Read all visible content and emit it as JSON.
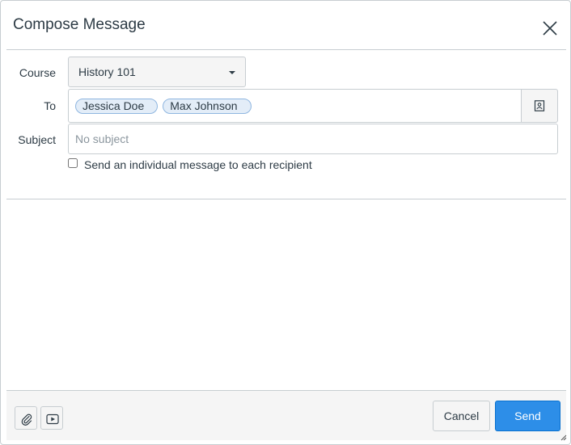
{
  "dialog": {
    "title": "Compose Message"
  },
  "form": {
    "course_label": "Course",
    "course_value": "History 101",
    "to_label": "To",
    "recipients": [
      "Jessica Doe",
      "Max Johnson"
    ],
    "subject_label": "Subject",
    "subject_placeholder": "No subject",
    "subject_value": "",
    "individual_message_label": "Send an individual message to each recipient",
    "individual_message_checked": false
  },
  "footer": {
    "cancel_label": "Cancel",
    "send_label": "Send"
  },
  "icons": {
    "close": "close-icon",
    "address_book": "address-book-icon",
    "attach": "paperclip-icon",
    "media": "media-icon",
    "course_dropdown": "caret-down-icon"
  },
  "colors": {
    "accent": "#2d8ee8",
    "token_bg": "#e3edf8",
    "token_border": "#8fb6e0",
    "footer_bg": "#f5f5f5",
    "border": "#c7cdd1"
  }
}
